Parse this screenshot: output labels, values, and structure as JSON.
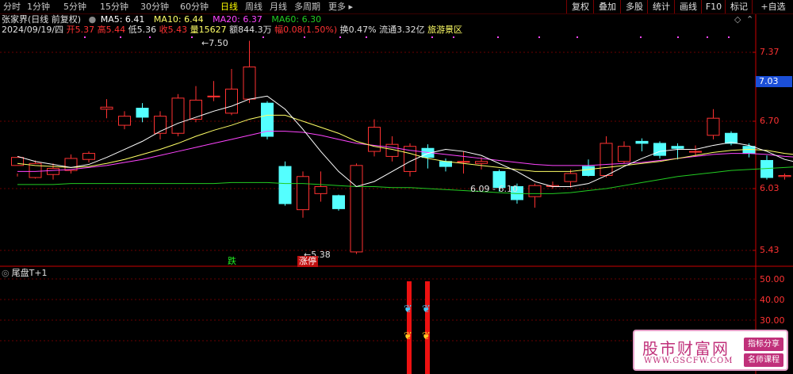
{
  "toolbar": {
    "periods": [
      "分时",
      "1分钟",
      "5分钟",
      "15分钟",
      "30分钟",
      "60分钟",
      "日线",
      "周线",
      "月线",
      "多周期",
      "更多 ▸"
    ],
    "active_period": "日线",
    "buttons": [
      "复权",
      "叠加",
      "多股",
      "统计",
      "画线",
      "F10",
      "标记",
      "+自选"
    ]
  },
  "header": {
    "stock_name": "张家界(日线 前复权)",
    "ma5": "MA5: 6.41",
    "ma10": "MA10: 6.44",
    "ma20": "MA20: 6.37",
    "ma60": "MA60: 6.30",
    "date": "2024/09/19/四",
    "open": "开5.37",
    "high": "高5.44",
    "low": "低5.36",
    "close": "收5.43",
    "volume": "量15627",
    "amount": "额844.3万",
    "change": "幅0.08(1.50%)",
    "turnover": "换0.47%",
    "float_cap": "流通3.32亿",
    "sector": "旅游景区"
  },
  "axis": {
    "price_labels": [
      "7.37",
      "6.70",
      "6.03",
      "5.43"
    ],
    "current_price": "7.03",
    "indicator_labels": [
      "50.00",
      "40.00",
      "30.00"
    ]
  },
  "annotations": {
    "high_mark": "←7.50",
    "low_mark": "←5.38",
    "range_mark": "6.09 - 6.10",
    "tag_down": "跌",
    "tag_limit": "涨停"
  },
  "indicator": {
    "title": "尾盘T+1"
  },
  "colors": {
    "up": "#ff3232",
    "down": "#54ffff",
    "ma5": "#ffffff",
    "ma10": "#ffff66",
    "ma20": "#ff44ff",
    "ma60": "#22cc22",
    "grid": "#6a0000",
    "axis": "#cc0000"
  },
  "watermark": {
    "main": "股市财富网",
    "url": "WWW.GSCFW.COM",
    "tag1": "指标分享",
    "tag2": "名师课程"
  }
}
